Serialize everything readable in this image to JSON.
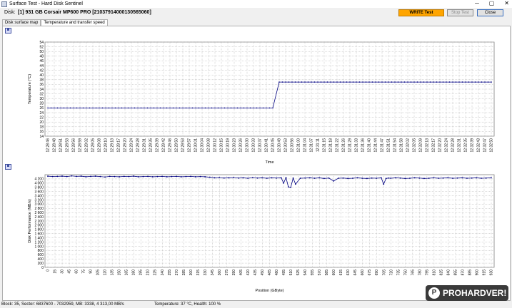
{
  "window": {
    "title": "Surface Test - Hard Disk Sentinel",
    "minimize": "─",
    "maximize": "▢",
    "close": "✕"
  },
  "toolbar": {
    "disk_label": "Disk:",
    "disk_value": "[1] 931 GB  Corsair MP600 PRO [21037914000130565060]",
    "write_test": "WRITE Test",
    "stop_test": "Stop Test",
    "close": "Close"
  },
  "tabs": [
    {
      "label": "Disk surface map"
    },
    {
      "label": "Temperature and transfer speed"
    }
  ],
  "status": {
    "block_info": "Block: 35, Sector: 6837600 - 7032959, MB: 3338, 4 313,00 MB/s",
    "temp_info": "Temperature: 37  °C,  Health: 100 %"
  },
  "watermark": {
    "text": "PROHARDVER!",
    "icon": "P"
  },
  "chart_data": [
    {
      "type": "line",
      "ylabel": "Temperature (°C)",
      "xlabel": "Time",
      "ylim": [
        14,
        54
      ],
      "y_ticks": [
        14,
        16,
        18,
        20,
        22,
        24,
        26,
        28,
        30,
        32,
        34,
        36,
        38,
        40,
        42,
        44,
        46,
        48,
        50,
        52,
        54
      ],
      "x_ticks": [
        "12:28:46",
        "12:28:48",
        "12:28:51",
        "12:28:53",
        "12:28:56",
        "12:28:59",
        "12:29:02",
        "12:29:05",
        "12:29:08",
        "12:29:10",
        "12:29:13",
        "12:29:17",
        "12:29:20",
        "12:29:24",
        "12:29:28",
        "12:29:31",
        "12:29:35",
        "12:29:39",
        "12:29:42",
        "12:29:46",
        "12:29:50",
        "12:29:53",
        "12:29:57",
        "12:30:01",
        "12:30:04",
        "12:30:08",
        "12:30:12",
        "12:30:15",
        "12:30:19",
        "12:30:23",
        "12:30:26",
        "12:30:30",
        "12:30:33",
        "12:30:37",
        "12:30:41",
        "12:30:45",
        "12:30:49",
        "12:30:53",
        "12:30:56",
        "12:31:00",
        "12:31:04",
        "12:31:07",
        "12:31:11",
        "12:31:15",
        "12:31:18",
        "12:31:22",
        "12:31:26",
        "12:31:29",
        "12:31:33",
        "12:31:36",
        "12:31:40",
        "12:31:44",
        "12:31:47",
        "12:31:51",
        "12:31:54",
        "12:31:58",
        "12:32:02",
        "12:32:05",
        "12:32:09",
        "12:32:13",
        "12:32:17",
        "12:32:20",
        "12:32:24",
        "12:32:28",
        "12:32:31",
        "12:32:35",
        "12:32:39",
        "12:32:43",
        "12:32:47",
        "12:32:50"
      ],
      "series": [
        {
          "segments": [
            {
              "x_index": [
                0,
                35
              ],
              "y": 26
            },
            {
              "x_index": [
                36,
                69
              ],
              "y": 37
            }
          ]
        }
      ],
      "grid": true,
      "color": "#000080"
    },
    {
      "type": "line",
      "ylabel": "Disk Performance (MB/s)",
      "xlabel": "Position (GByte)",
      "ylim": [
        0,
        4400
      ],
      "y_ticks": [
        0,
        200,
        400,
        600,
        800,
        1000,
        1200,
        1400,
        1600,
        1800,
        2000,
        2200,
        2400,
        2600,
        2800,
        3000,
        3200,
        3400,
        3600,
        3800,
        4000,
        4200
      ],
      "y_tick_labels": [
        "0",
        "200",
        "400",
        "600",
        "800",
        "1 000",
        "1 200",
        "1 400",
        "1 600",
        "1 800",
        "2 000",
        "2 200",
        "2 400",
        "2 600",
        "2 800",
        "3 000",
        "3 200",
        "3 400",
        "3 600",
        "3 800",
        "4 000",
        "4 200"
      ],
      "x_ticks": [
        "0",
        "15",
        "30",
        "45",
        "60",
        "75",
        "90",
        "105",
        "120",
        "135",
        "150",
        "165",
        "180",
        "195",
        "210",
        "225",
        "240",
        "255",
        "270",
        "285",
        "300",
        "315",
        "330",
        "345",
        "360",
        "375",
        "390",
        "405",
        "420",
        "435",
        "450",
        "465",
        "480",
        "495",
        "510",
        "525",
        "540",
        "555",
        "570",
        "585",
        "600",
        "615",
        "630",
        "645",
        "660",
        "675",
        "690",
        "705",
        "720",
        "735",
        "750",
        "765",
        "780",
        "795",
        "810",
        "825",
        "840",
        "855",
        "870",
        "885",
        "900",
        "915",
        "930"
      ],
      "xlim": [
        0,
        931
      ],
      "series": [
        {
          "x": [
            0,
            10,
            20,
            30,
            40,
            50,
            60,
            70,
            80,
            90,
            100,
            110,
            120,
            130,
            140,
            150,
            160,
            170,
            180,
            190,
            200,
            210,
            220,
            230,
            240,
            250,
            260,
            270,
            280,
            290,
            300,
            310,
            320,
            330,
            340,
            350,
            360,
            370,
            380,
            390,
            400,
            410,
            420,
            430,
            440,
            450,
            460,
            470,
            480,
            490,
            495,
            500,
            505,
            510,
            515,
            520,
            530,
            540,
            550,
            560,
            570,
            580,
            590,
            600,
            610,
            620,
            630,
            640,
            650,
            660,
            670,
            680,
            690,
            700,
            705,
            710,
            715,
            720,
            730,
            740,
            750,
            760,
            770,
            780,
            790,
            800,
            810,
            820,
            830,
            840,
            850,
            860,
            870,
            880,
            890,
            900,
            910,
            920,
            931
          ],
          "values": [
            4330,
            4310,
            4320,
            4330,
            4310,
            4340,
            4320,
            4330,
            4300,
            4320,
            4330,
            4310,
            4290,
            4320,
            4310,
            4300,
            4320,
            4310,
            4330,
            4300,
            4310,
            4320,
            4300,
            4310,
            4320,
            4300,
            4310,
            4320,
            4300,
            4310,
            4320,
            4300,
            4310,
            4300,
            4280,
            4250,
            4260,
            4240,
            4250,
            4260,
            4240,
            4250,
            4230,
            4260,
            4240,
            4250,
            4230,
            4250,
            4240,
            4250,
            4000,
            4260,
            3820,
            3800,
            4240,
            3950,
            4230,
            4240,
            4250,
            4230,
            4250,
            4220,
            4240,
            4100,
            4230,
            4240,
            4220,
            4230,
            4250,
            4230,
            4220,
            4240,
            4230,
            4250,
            3950,
            4220,
            4240,
            4230,
            4250,
            4240,
            4220,
            4230,
            4250,
            4240,
            4220,
            4230,
            4250,
            4230,
            4240,
            4250,
            4230,
            4240,
            4250,
            4230,
            4240,
            4250,
            4230,
            4240,
            4250
          ]
        }
      ],
      "grid": true,
      "color": "#000080"
    }
  ]
}
